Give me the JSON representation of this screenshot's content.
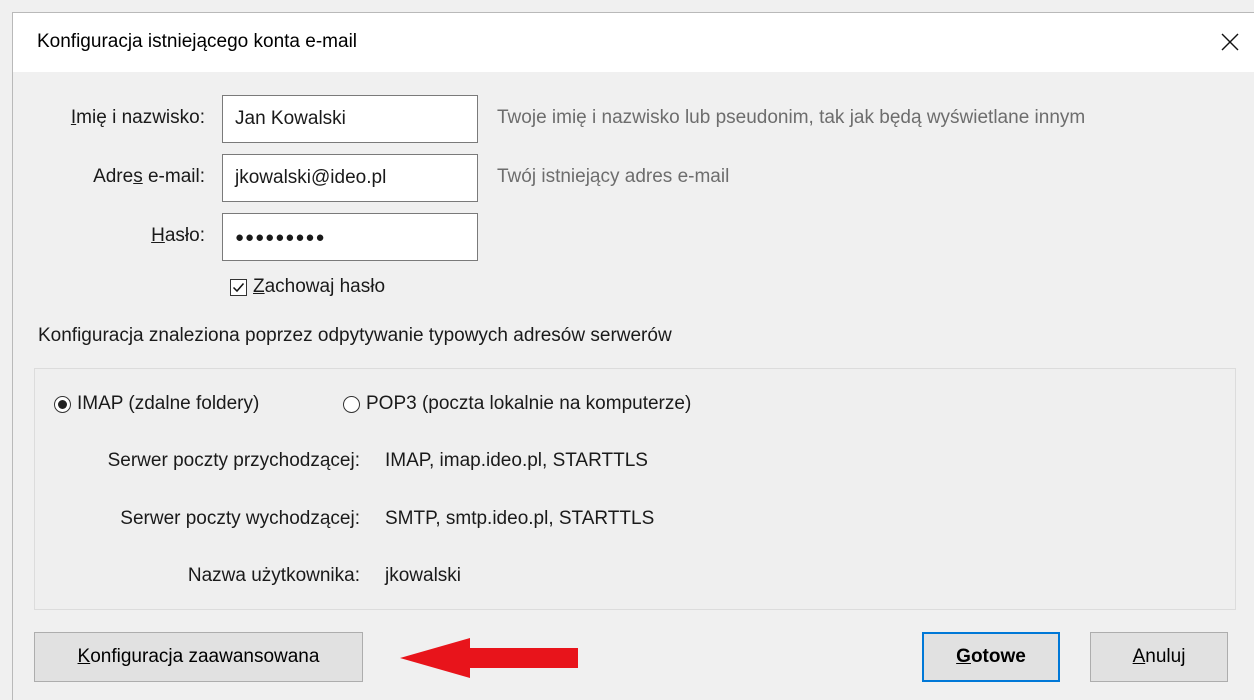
{
  "window": {
    "title": "Konfiguracja istniejącego konta e-mail",
    "close_icon": "close-icon"
  },
  "form": {
    "name": {
      "label_pre": "",
      "label_ul": "I",
      "label_post": "mię i nazwisko:",
      "value": "Jan Kowalski",
      "hint": "Twoje imię i nazwisko lub pseudonim, tak jak będą wyświetlane innym"
    },
    "email": {
      "label_pre": "Adre",
      "label_ul": "s",
      "label_post": " e-mail:",
      "value": "jkowalski@ideo.pl",
      "hint": "Twój istniejący adres e-mail"
    },
    "password": {
      "label_pre": "",
      "label_ul": "H",
      "label_post": "asło:",
      "value": "●●●●●●●●●"
    },
    "remember": {
      "checked": true,
      "label_ul": "Z",
      "label_post": "achowaj hasło"
    }
  },
  "config_note": "Konfiguracja znaleziona poprzez odpytywanie typowych adresów serwerów",
  "protocol": {
    "imap_label": "IMAP (zdalne foldery)",
    "pop3_label": "POP3 (poczta lokalnie na komputerze)",
    "selected": "IMAP"
  },
  "servers": {
    "incoming_label": "Serwer poczty przychodzącej:",
    "incoming_value": "IMAP, imap.ideo.pl, STARTTLS",
    "outgoing_label": "Serwer poczty wychodzącej:",
    "outgoing_value": "SMTP, smtp.ideo.pl, STARTTLS",
    "username_label": "Nazwa użytkownika:",
    "username_value": "jkowalski"
  },
  "buttons": {
    "advanced_ul": "K",
    "advanced_post": "onfiguracja zaawansowana",
    "done_ul": "G",
    "done_post": "otowe",
    "cancel_ul": "A",
    "cancel_post": "nuluj"
  },
  "annotation": {
    "arrow_color": "#e8141b",
    "arrow_icon": "arrow-left-icon"
  }
}
